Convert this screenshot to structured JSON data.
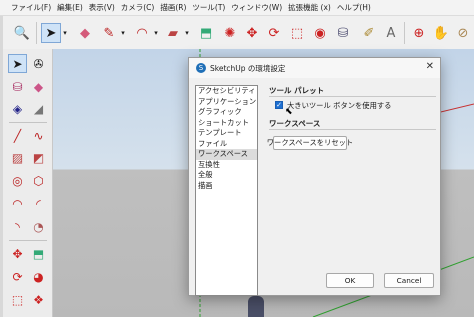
{
  "menu": [
    "ファイル(F)",
    "編集(E)",
    "表示(V)",
    "カメラ(C)",
    "描画(R)",
    "ツール(T)",
    "ウィンドウ(W)",
    "拡張機能 (x)",
    "ヘルプ(H)"
  ],
  "toolbar_icons": [
    "zoom-icon",
    "select-icon",
    "dropdown-icon",
    "eraser-icon",
    "pencil-icon",
    "dropdown-icon",
    "arc-icon",
    "dropdown-icon",
    "rectangle-icon",
    "dropdown-icon",
    "pushpull-icon",
    "move-icon",
    "rotate-icon",
    "scale-icon",
    "offset-icon",
    "tape-measure-icon",
    "paint-bucket-icon",
    "orbit-icon",
    "pan-icon",
    "section-icon",
    "walk-icon"
  ],
  "dialog": {
    "title": "SketchUp の環境設定",
    "close": "✕",
    "categories": [
      "アクセシビリティ",
      "アプリケーション",
      "グラフィック",
      "ショートカット",
      "テンプレート",
      "ファイル",
      "ワークスペース",
      "互換性",
      "全般",
      "描画"
    ],
    "selected_category": "ワークスペース",
    "tool_palette": {
      "heading": "ツール パレット",
      "large_buttons_label": "大きいツール ボタンを使用する",
      "large_buttons_checked": true
    },
    "workspace": {
      "heading": "ワークスペース",
      "reset_button": "ワークスペースをリセット"
    },
    "ok": "OK",
    "cancel": "Cancel"
  },
  "colors": {
    "accent": "#1e6fd1",
    "sketchup_blue": "#1f6fb7",
    "axis_green": "#2fa02f",
    "axis_red": "#c83232"
  }
}
